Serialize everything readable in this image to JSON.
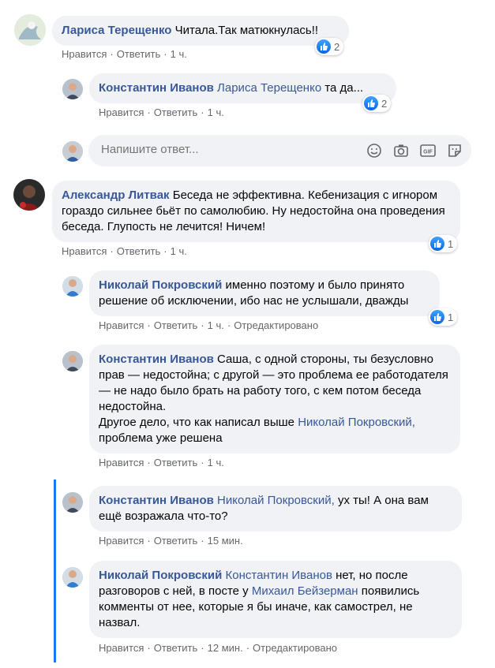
{
  "actions": {
    "like": "Нравится",
    "reply": "Ответить",
    "edited": "Отредактировано"
  },
  "colors": {
    "link": "#385898",
    "meta": "#65676b",
    "bubble": "#f0f2f5",
    "accent": "#1877f2"
  },
  "comments": [
    {
      "author": "Лариса Терещенко",
      "text": "Читала.Так матюкнулась!!",
      "time": "1 ч.",
      "reactions": "2"
    },
    {
      "author": "Константин Иванов",
      "mention": "Лариса Терещенко",
      "text": "та да...",
      "time": "1 ч.",
      "reactions": "2"
    },
    {
      "author": "Александр Литвак",
      "text": "Беседа не эффективна. Кебенизация с игнором гораздо сильнее бьёт по самолюбию. Ну недостойна она проведения беседа. Глупость не лечится! Ничем!",
      "time": "1 ч.",
      "reactions": "1"
    },
    {
      "author": "Николай Покровский",
      "text": "именно поэтому и было принято решение об исключении, ибо нас не услышали, дважды",
      "time": "1 ч.",
      "reactions": "1"
    },
    {
      "author": "Константин Иванов",
      "text": "Саша, с одной стороны, ты безусловно прав — недостойна; с другой — это проблема ее работодателя — не надо было брать на работу того, с кем потом беседа недостойна.",
      "text2": "Другое дело, что как написал выше",
      "mention": "Николай Покровский,",
      "text3": "проблема уже решена",
      "time": "1 ч."
    },
    {
      "author": "Константин Иванов",
      "mention": "Николай Покровский,",
      "text": "ух ты! А она вам ещё возражала что-то?",
      "time": "15 мин."
    },
    {
      "author": "Николай Покровский",
      "mention": "Константин Иванов",
      "text": "нет, но после разговоров с ней, в посте у",
      "mention2": "Михаил Бейзерман",
      "text2": "появились комменты от нее, которые я бы иначе, как самострел, не назвал.",
      "time": "12 мин."
    }
  ],
  "reply_box": {
    "placeholder": "Напишите ответ..."
  },
  "icons": [
    "emoji-icon",
    "camera-icon",
    "gif-icon",
    "sticker-icon",
    "like-icon"
  ]
}
